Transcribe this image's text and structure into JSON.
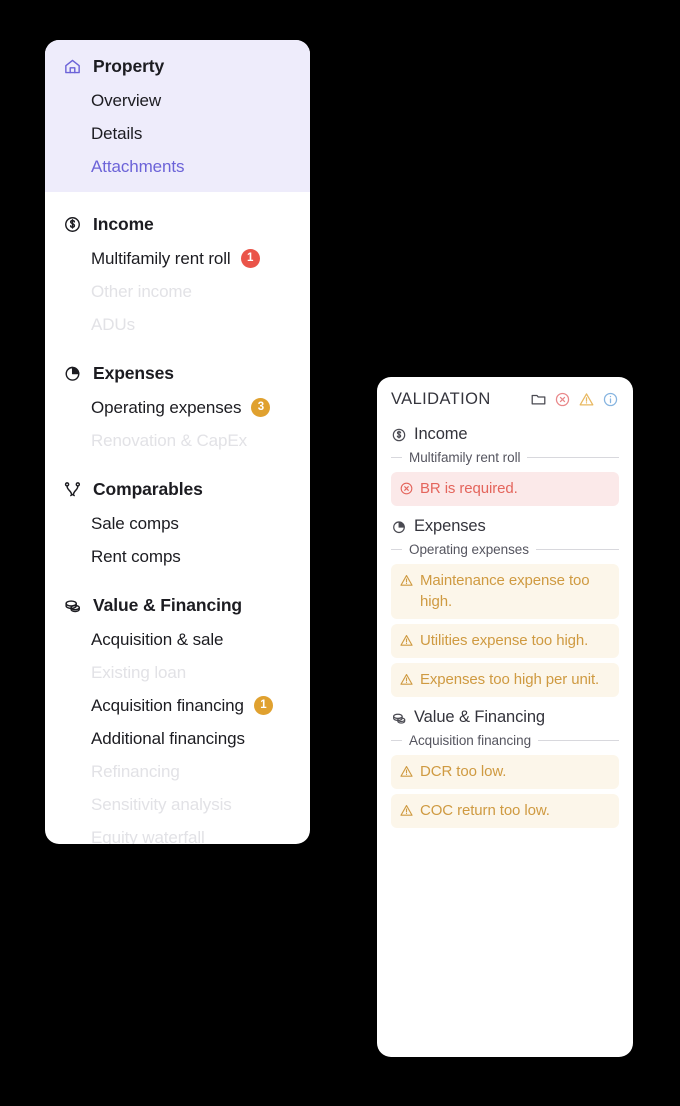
{
  "colors": {
    "accent_purple": "#6c63d8",
    "highlight_bg": "#eeecfb",
    "badge_red": "#ea5449",
    "badge_amber": "#e0a12f",
    "error_text": "#e4655c",
    "error_bg": "#fbe9e9",
    "warn_text": "#cf9a41",
    "warn_bg": "#fcf6ea",
    "disabled_text": "#e2e2e6",
    "card_bg": "#ffffff",
    "page_bg": "#000000"
  },
  "sidebar": {
    "groups": [
      {
        "title": "Property",
        "icon": "home-icon",
        "highlighted": true,
        "items": [
          {
            "label": "Overview",
            "state": "normal",
            "badge": null
          },
          {
            "label": "Details",
            "state": "normal",
            "badge": null
          },
          {
            "label": "Attachments",
            "state": "accent",
            "badge": null
          }
        ]
      },
      {
        "title": "Income",
        "icon": "dollar-circle-icon",
        "highlighted": false,
        "items": [
          {
            "label": "Multifamily rent roll",
            "state": "normal",
            "badge": "1",
            "badge_color": "red"
          },
          {
            "label": "Other income",
            "state": "disabled",
            "badge": null
          },
          {
            "label": "ADUs",
            "state": "disabled",
            "badge": null
          }
        ]
      },
      {
        "title": "Expenses",
        "icon": "pie-chart-icon",
        "highlighted": false,
        "items": [
          {
            "label": "Operating expenses",
            "state": "normal",
            "badge": "3",
            "badge_color": "amber"
          },
          {
            "label": "Renovation & CapEx",
            "state": "disabled",
            "badge": null
          }
        ]
      },
      {
        "title": "Comparables",
        "icon": "compare-nodes-icon",
        "highlighted": false,
        "items": [
          {
            "label": "Sale comps",
            "state": "normal",
            "badge": null
          },
          {
            "label": "Rent comps",
            "state": "normal",
            "badge": null
          }
        ]
      },
      {
        "title": "Value & Financing",
        "icon": "coins-stack-icon",
        "highlighted": false,
        "items": [
          {
            "label": "Acquisition & sale",
            "state": "normal",
            "badge": null
          },
          {
            "label": "Existing loan",
            "state": "disabled",
            "badge": null
          },
          {
            "label": "Acquisition financing",
            "state": "normal",
            "badge": "1",
            "badge_color": "amber"
          },
          {
            "label": "Additional financings",
            "state": "normal",
            "badge": null
          },
          {
            "label": "Refinancing",
            "state": "disabled",
            "badge": null
          },
          {
            "label": "Sensitivity analysis",
            "state": "disabled",
            "badge": null
          },
          {
            "label": "Equity waterfall",
            "state": "disabled",
            "badge": null
          }
        ]
      }
    ]
  },
  "validation": {
    "title": "VALIDATION",
    "header_icons": [
      {
        "name": "folder-icon",
        "color": "#4a4a52"
      },
      {
        "name": "error-circle-x-icon",
        "color": "#e9888a"
      },
      {
        "name": "warning-triangle-icon",
        "color": "#e8b860"
      },
      {
        "name": "info-circle-icon",
        "color": "#86b4e0"
      }
    ],
    "sections": [
      {
        "title": "Income",
        "icon": "dollar-circle-icon",
        "subsection": "Multifamily rent roll",
        "messages": [
          {
            "severity": "error",
            "icon": "error-circle-x-icon",
            "text": "BR is required."
          }
        ]
      },
      {
        "title": "Expenses",
        "icon": "pie-chart-icon",
        "subsection": "Operating expenses",
        "messages": [
          {
            "severity": "warn",
            "icon": "warning-triangle-icon",
            "text": "Maintenance expense too high."
          },
          {
            "severity": "warn",
            "icon": "warning-triangle-icon",
            "text": "Utilities expense too high."
          },
          {
            "severity": "warn",
            "icon": "warning-triangle-icon",
            "text": "Expenses too high per unit."
          }
        ]
      },
      {
        "title": "Value & Financing",
        "icon": "coins-stack-icon",
        "subsection": "Acquisition financing",
        "messages": [
          {
            "severity": "warn",
            "icon": "warning-triangle-icon",
            "text": "DCR too low."
          },
          {
            "severity": "warn",
            "icon": "warning-triangle-icon",
            "text": "COC return too low."
          }
        ]
      }
    ]
  }
}
